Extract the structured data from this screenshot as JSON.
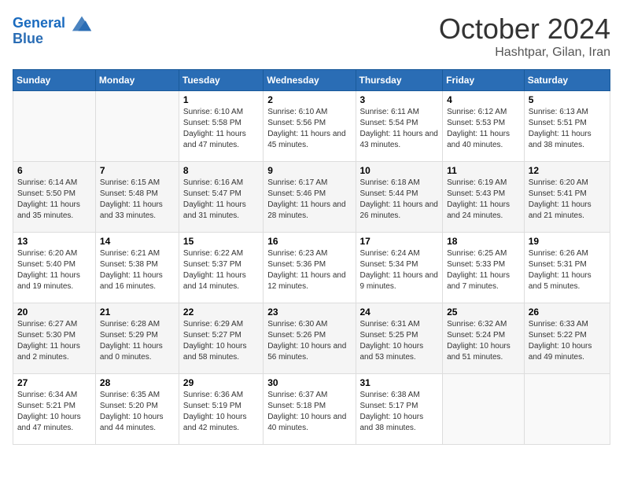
{
  "header": {
    "logo_line1": "General",
    "logo_line2": "Blue",
    "title": "October 2024",
    "subtitle": "Hashtpar, Gilan, Iran"
  },
  "days_of_week": [
    "Sunday",
    "Monday",
    "Tuesday",
    "Wednesday",
    "Thursday",
    "Friday",
    "Saturday"
  ],
  "weeks": [
    [
      {
        "num": "",
        "sunrise": "",
        "sunset": "",
        "daylight": "",
        "empty": true
      },
      {
        "num": "",
        "sunrise": "",
        "sunset": "",
        "daylight": "",
        "empty": true
      },
      {
        "num": "1",
        "sunrise": "Sunrise: 6:10 AM",
        "sunset": "Sunset: 5:58 PM",
        "daylight": "Daylight: 11 hours and 47 minutes."
      },
      {
        "num": "2",
        "sunrise": "Sunrise: 6:10 AM",
        "sunset": "Sunset: 5:56 PM",
        "daylight": "Daylight: 11 hours and 45 minutes."
      },
      {
        "num": "3",
        "sunrise": "Sunrise: 6:11 AM",
        "sunset": "Sunset: 5:54 PM",
        "daylight": "Daylight: 11 hours and 43 minutes."
      },
      {
        "num": "4",
        "sunrise": "Sunrise: 6:12 AM",
        "sunset": "Sunset: 5:53 PM",
        "daylight": "Daylight: 11 hours and 40 minutes."
      },
      {
        "num": "5",
        "sunrise": "Sunrise: 6:13 AM",
        "sunset": "Sunset: 5:51 PM",
        "daylight": "Daylight: 11 hours and 38 minutes."
      }
    ],
    [
      {
        "num": "6",
        "sunrise": "Sunrise: 6:14 AM",
        "sunset": "Sunset: 5:50 PM",
        "daylight": "Daylight: 11 hours and 35 minutes."
      },
      {
        "num": "7",
        "sunrise": "Sunrise: 6:15 AM",
        "sunset": "Sunset: 5:48 PM",
        "daylight": "Daylight: 11 hours and 33 minutes."
      },
      {
        "num": "8",
        "sunrise": "Sunrise: 6:16 AM",
        "sunset": "Sunset: 5:47 PM",
        "daylight": "Daylight: 11 hours and 31 minutes."
      },
      {
        "num": "9",
        "sunrise": "Sunrise: 6:17 AM",
        "sunset": "Sunset: 5:46 PM",
        "daylight": "Daylight: 11 hours and 28 minutes."
      },
      {
        "num": "10",
        "sunrise": "Sunrise: 6:18 AM",
        "sunset": "Sunset: 5:44 PM",
        "daylight": "Daylight: 11 hours and 26 minutes."
      },
      {
        "num": "11",
        "sunrise": "Sunrise: 6:19 AM",
        "sunset": "Sunset: 5:43 PM",
        "daylight": "Daylight: 11 hours and 24 minutes."
      },
      {
        "num": "12",
        "sunrise": "Sunrise: 6:20 AM",
        "sunset": "Sunset: 5:41 PM",
        "daylight": "Daylight: 11 hours and 21 minutes."
      }
    ],
    [
      {
        "num": "13",
        "sunrise": "Sunrise: 6:20 AM",
        "sunset": "Sunset: 5:40 PM",
        "daylight": "Daylight: 11 hours and 19 minutes."
      },
      {
        "num": "14",
        "sunrise": "Sunrise: 6:21 AM",
        "sunset": "Sunset: 5:38 PM",
        "daylight": "Daylight: 11 hours and 16 minutes."
      },
      {
        "num": "15",
        "sunrise": "Sunrise: 6:22 AM",
        "sunset": "Sunset: 5:37 PM",
        "daylight": "Daylight: 11 hours and 14 minutes."
      },
      {
        "num": "16",
        "sunrise": "Sunrise: 6:23 AM",
        "sunset": "Sunset: 5:36 PM",
        "daylight": "Daylight: 11 hours and 12 minutes."
      },
      {
        "num": "17",
        "sunrise": "Sunrise: 6:24 AM",
        "sunset": "Sunset: 5:34 PM",
        "daylight": "Daylight: 11 hours and 9 minutes."
      },
      {
        "num": "18",
        "sunrise": "Sunrise: 6:25 AM",
        "sunset": "Sunset: 5:33 PM",
        "daylight": "Daylight: 11 hours and 7 minutes."
      },
      {
        "num": "19",
        "sunrise": "Sunrise: 6:26 AM",
        "sunset": "Sunset: 5:31 PM",
        "daylight": "Daylight: 11 hours and 5 minutes."
      }
    ],
    [
      {
        "num": "20",
        "sunrise": "Sunrise: 6:27 AM",
        "sunset": "Sunset: 5:30 PM",
        "daylight": "Daylight: 11 hours and 2 minutes."
      },
      {
        "num": "21",
        "sunrise": "Sunrise: 6:28 AM",
        "sunset": "Sunset: 5:29 PM",
        "daylight": "Daylight: 11 hours and 0 minutes."
      },
      {
        "num": "22",
        "sunrise": "Sunrise: 6:29 AM",
        "sunset": "Sunset: 5:27 PM",
        "daylight": "Daylight: 10 hours and 58 minutes."
      },
      {
        "num": "23",
        "sunrise": "Sunrise: 6:30 AM",
        "sunset": "Sunset: 5:26 PM",
        "daylight": "Daylight: 10 hours and 56 minutes."
      },
      {
        "num": "24",
        "sunrise": "Sunrise: 6:31 AM",
        "sunset": "Sunset: 5:25 PM",
        "daylight": "Daylight: 10 hours and 53 minutes."
      },
      {
        "num": "25",
        "sunrise": "Sunrise: 6:32 AM",
        "sunset": "Sunset: 5:24 PM",
        "daylight": "Daylight: 10 hours and 51 minutes."
      },
      {
        "num": "26",
        "sunrise": "Sunrise: 6:33 AM",
        "sunset": "Sunset: 5:22 PM",
        "daylight": "Daylight: 10 hours and 49 minutes."
      }
    ],
    [
      {
        "num": "27",
        "sunrise": "Sunrise: 6:34 AM",
        "sunset": "Sunset: 5:21 PM",
        "daylight": "Daylight: 10 hours and 47 minutes."
      },
      {
        "num": "28",
        "sunrise": "Sunrise: 6:35 AM",
        "sunset": "Sunset: 5:20 PM",
        "daylight": "Daylight: 10 hours and 44 minutes."
      },
      {
        "num": "29",
        "sunrise": "Sunrise: 6:36 AM",
        "sunset": "Sunset: 5:19 PM",
        "daylight": "Daylight: 10 hours and 42 minutes."
      },
      {
        "num": "30",
        "sunrise": "Sunrise: 6:37 AM",
        "sunset": "Sunset: 5:18 PM",
        "daylight": "Daylight: 10 hours and 40 minutes."
      },
      {
        "num": "31",
        "sunrise": "Sunrise: 6:38 AM",
        "sunset": "Sunset: 5:17 PM",
        "daylight": "Daylight: 10 hours and 38 minutes."
      },
      {
        "num": "",
        "sunrise": "",
        "sunset": "",
        "daylight": "",
        "empty": true
      },
      {
        "num": "",
        "sunrise": "",
        "sunset": "",
        "daylight": "",
        "empty": true
      }
    ]
  ]
}
